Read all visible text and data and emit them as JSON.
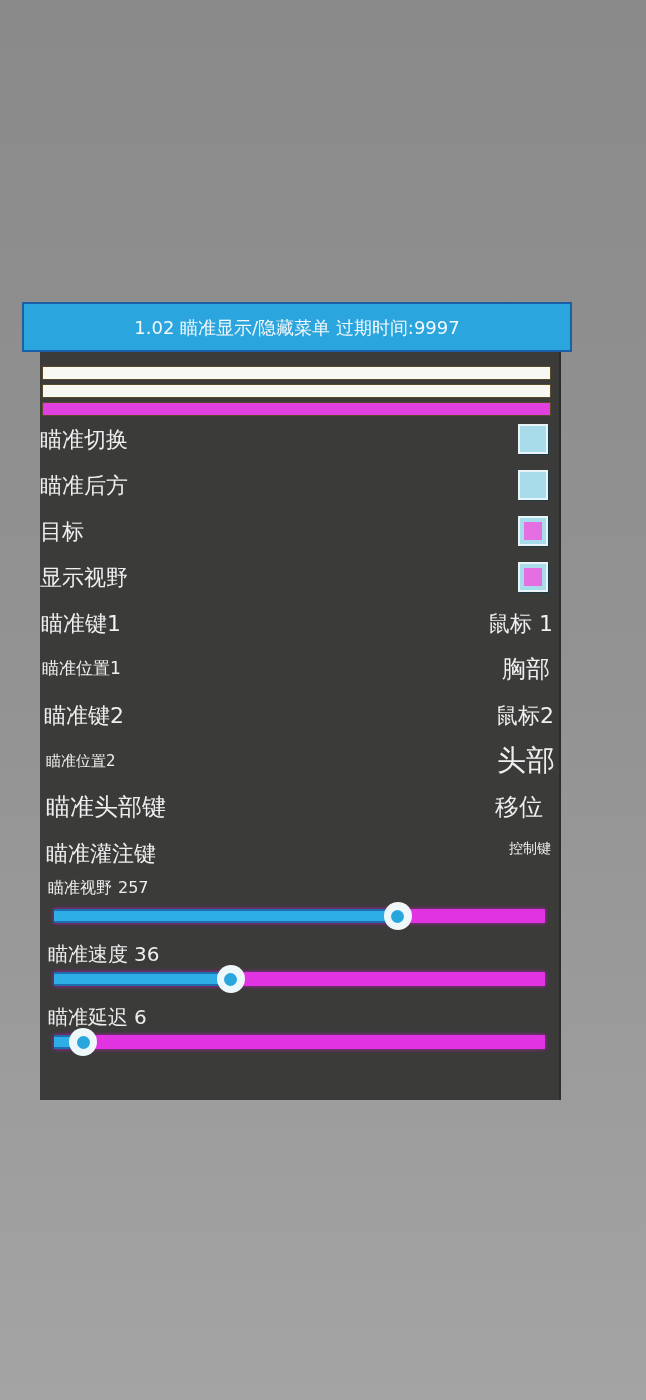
{
  "title": "1.02 瞄准显示/隐藏菜单 过期时间:9997",
  "color_bars": [
    {
      "color": "#f8f8f2"
    },
    {
      "color": "#f8f8f2"
    },
    {
      "color": "#e040e0"
    }
  ],
  "toggles": [
    {
      "label": "瞄准切换",
      "checked": false
    },
    {
      "label": "瞄准后方",
      "checked": false
    },
    {
      "label": "目标",
      "checked": true
    },
    {
      "label": "显示视野",
      "checked": true
    }
  ],
  "bindings": [
    {
      "label": "瞄准键1",
      "value": "鼠标 1"
    },
    {
      "label": "瞄准位置1",
      "value": "胸部"
    },
    {
      "label": "瞄准键2",
      "value": "鼠标2"
    },
    {
      "label": "瞄准位置2",
      "value": "头部"
    },
    {
      "label": "瞄准头部键",
      "value": "移位"
    },
    {
      "label": "瞄准灌注键",
      "value": "控制键"
    }
  ],
  "sliders": [
    {
      "label": "瞄准视野",
      "reading": "257",
      "level": 0.7
    },
    {
      "label": "瞄准速度",
      "reading": "36",
      "level": 0.36
    },
    {
      "label": "瞄准延迟",
      "reading": "6",
      "level": 0.06
    }
  ]
}
